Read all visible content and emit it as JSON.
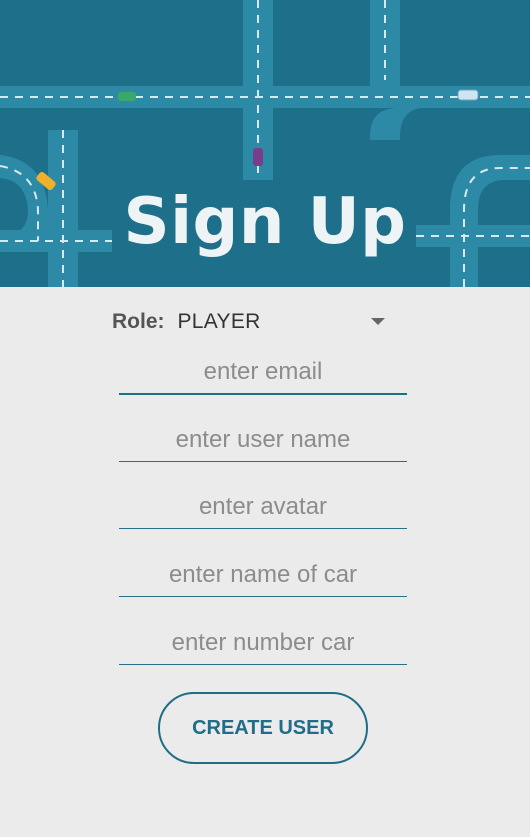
{
  "header": {
    "title": "Sign Up",
    "bg_color": "#1e6f8a",
    "road_color": "#2d8aa6"
  },
  "role": {
    "label": "Role:",
    "value": "PLAYER"
  },
  "fields": {
    "email_placeholder": "enter email",
    "username_placeholder": "enter user name",
    "avatar_placeholder": "enter avatar",
    "car_name_placeholder": "enter name of car",
    "car_number_placeholder": "enter number car"
  },
  "actions": {
    "create_label": "CREATE USER"
  },
  "colors": {
    "accent": "#1f6d87",
    "background": "#ebebeb"
  }
}
